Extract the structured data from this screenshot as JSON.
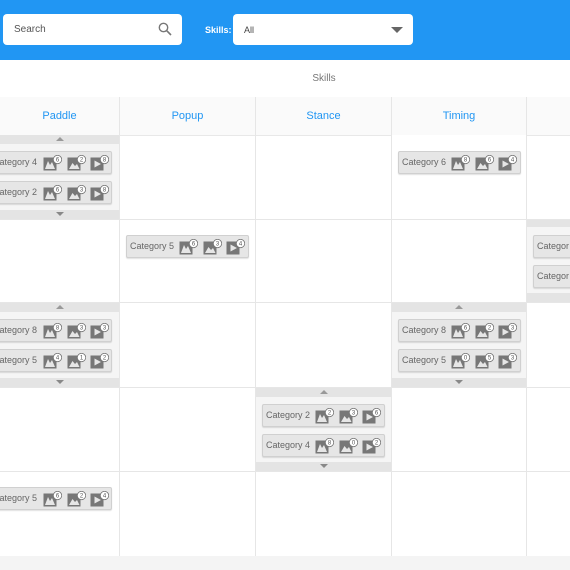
{
  "search": {
    "placeholder": "Search"
  },
  "filter": {
    "label": "Skills:",
    "value": "All"
  },
  "table": {
    "title": "Skills",
    "columns": [
      "Paddle",
      "Popup",
      "Stance",
      "Timing"
    ]
  },
  "cards": [
    {
      "label": "Category 4",
      "counts": [
        "6",
        "2",
        "8"
      ]
    },
    {
      "label": "Category 2",
      "counts": [
        "6",
        "3",
        "8"
      ]
    },
    {
      "label": "Category 6",
      "counts": [
        "8",
        "6",
        "4"
      ]
    },
    {
      "label": "Category 5",
      "counts": [
        "6",
        "3",
        "4"
      ]
    },
    {
      "label": "Categor"
    },
    {
      "label": "Categor"
    },
    {
      "label": "Category 8",
      "counts": [
        "8",
        "3",
        "3"
      ]
    },
    {
      "label": "Category 5",
      "counts": [
        "4",
        "1",
        "2"
      ]
    },
    {
      "label": "Category 8",
      "counts": [
        "6",
        "2",
        "3"
      ]
    },
    {
      "label": "Category 5",
      "counts": [
        "0",
        "5",
        "3"
      ]
    },
    {
      "label": "Category 2",
      "counts": [
        "2",
        "3",
        "6"
      ]
    },
    {
      "label": "Category 4",
      "counts": [
        "8",
        "0",
        "2"
      ]
    },
    {
      "label": "Category 5",
      "counts": [
        "6",
        "2",
        "4"
      ]
    }
  ]
}
